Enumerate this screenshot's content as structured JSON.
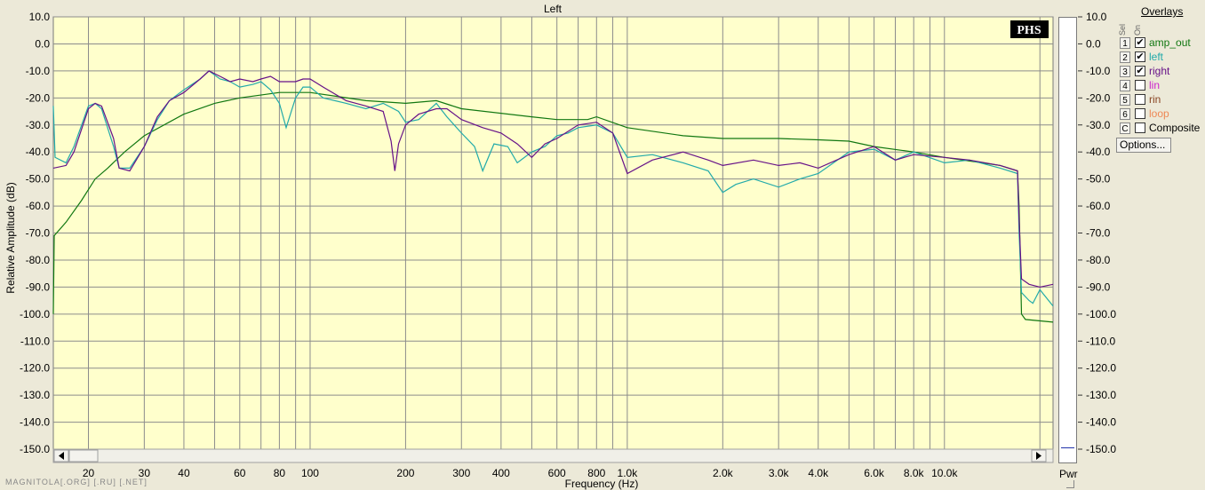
{
  "chart_data": {
    "type": "line",
    "title": "Left",
    "xlabel": "Frequency (Hz)",
    "ylabel": "Relative Amplitude (dB)",
    "x_scale": "log",
    "xlim": [
      15.5,
      22000
    ],
    "ylim": [
      -150,
      10
    ],
    "grid": true,
    "y_ticks": [
      "10.0",
      "0.0",
      "-10.0",
      "-20.0",
      "-30.0",
      "-40.0",
      "-50.0",
      "-60.0",
      "-70.0",
      "-80.0",
      "-90.0",
      "-100.0",
      "-110.0",
      "-120.0",
      "-130.0",
      "-140.0",
      "-150.0"
    ],
    "x_tick_labels": [
      {
        "f": 20,
        "t": "20"
      },
      {
        "f": 30,
        "t": "30"
      },
      {
        "f": 40,
        "t": "40"
      },
      {
        "f": 60,
        "t": "60"
      },
      {
        "f": 80,
        "t": "80"
      },
      {
        "f": 100,
        "t": "100"
      },
      {
        "f": 200,
        "t": "200"
      },
      {
        "f": 300,
        "t": "300"
      },
      {
        "f": 400,
        "t": "400"
      },
      {
        "f": 600,
        "t": "600"
      },
      {
        "f": 800,
        "t": "800"
      },
      {
        "f": 1000,
        "t": "1.0k"
      },
      {
        "f": 2000,
        "t": "2.0k"
      },
      {
        "f": 3000,
        "t": "3.0k"
      },
      {
        "f": 4000,
        "t": "4.0k"
      },
      {
        "f": 6000,
        "t": "6.0k"
      },
      {
        "f": 8000,
        "t": "8.0k"
      },
      {
        "f": 10000,
        "t": "10.0k"
      }
    ],
    "series": [
      {
        "name": "amp_out",
        "color": "#117711",
        "points": [
          [
            15.5,
            -100
          ],
          [
            15.6,
            -71
          ],
          [
            17,
            -66
          ],
          [
            19,
            -58
          ],
          [
            21,
            -50
          ],
          [
            23,
            -46
          ],
          [
            26,
            -40
          ],
          [
            30,
            -34
          ],
          [
            40,
            -26
          ],
          [
            50,
            -22
          ],
          [
            60,
            -20
          ],
          [
            80,
            -18
          ],
          [
            100,
            -18
          ],
          [
            150,
            -21
          ],
          [
            200,
            -22
          ],
          [
            250,
            -21
          ],
          [
            300,
            -24
          ],
          [
            500,
            -27
          ],
          [
            600,
            -28
          ],
          [
            750,
            -28
          ],
          [
            800,
            -27
          ],
          [
            1000,
            -31
          ],
          [
            1500,
            -34
          ],
          [
            2000,
            -35
          ],
          [
            3000,
            -35
          ],
          [
            4000,
            -35.5
          ],
          [
            5000,
            -36
          ],
          [
            6000,
            -38
          ],
          [
            8000,
            -40
          ],
          [
            10000,
            -42
          ],
          [
            15000,
            -45
          ],
          [
            17000,
            -47
          ],
          [
            17200,
            -60
          ],
          [
            17500,
            -100
          ],
          [
            18000,
            -102
          ],
          [
            22000,
            -103
          ]
        ]
      },
      {
        "name": "left",
        "color": "#22aaaa",
        "points": [
          [
            15.5,
            -23
          ],
          [
            15.7,
            -42
          ],
          [
            17,
            -44
          ],
          [
            18,
            -38
          ],
          [
            20,
            -23
          ],
          [
            21,
            -22
          ],
          [
            22,
            -24
          ],
          [
            24,
            -38
          ],
          [
            25,
            -46
          ],
          [
            27,
            -46
          ],
          [
            30,
            -38
          ],
          [
            33,
            -28
          ],
          [
            36,
            -21
          ],
          [
            40,
            -17
          ],
          [
            45,
            -13
          ],
          [
            48,
            -10
          ],
          [
            52,
            -13
          ],
          [
            56,
            -14
          ],
          [
            60,
            -16
          ],
          [
            66,
            -15
          ],
          [
            70,
            -14
          ],
          [
            75,
            -17
          ],
          [
            80,
            -22
          ],
          [
            84,
            -31
          ],
          [
            90,
            -20
          ],
          [
            95,
            -16
          ],
          [
            100,
            -16
          ],
          [
            110,
            -20
          ],
          [
            130,
            -22
          ],
          [
            150,
            -24
          ],
          [
            170,
            -22
          ],
          [
            190,
            -25
          ],
          [
            200,
            -29
          ],
          [
            220,
            -28
          ],
          [
            250,
            -22
          ],
          [
            270,
            -27
          ],
          [
            300,
            -33
          ],
          [
            330,
            -38
          ],
          [
            350,
            -47
          ],
          [
            380,
            -37
          ],
          [
            420,
            -38
          ],
          [
            450,
            -44
          ],
          [
            500,
            -40
          ],
          [
            550,
            -38
          ],
          [
            600,
            -34
          ],
          [
            650,
            -33
          ],
          [
            700,
            -31
          ],
          [
            800,
            -30
          ],
          [
            900,
            -33
          ],
          [
            1000,
            -42
          ],
          [
            1200,
            -41
          ],
          [
            1500,
            -44
          ],
          [
            1800,
            -47
          ],
          [
            2000,
            -55
          ],
          [
            2200,
            -52
          ],
          [
            2500,
            -50
          ],
          [
            3000,
            -53
          ],
          [
            3500,
            -50
          ],
          [
            4000,
            -48
          ],
          [
            5000,
            -40
          ],
          [
            6000,
            -39
          ],
          [
            7000,
            -43
          ],
          [
            8000,
            -40
          ],
          [
            10000,
            -44
          ],
          [
            12000,
            -43
          ],
          [
            15000,
            -46
          ],
          [
            17000,
            -48
          ],
          [
            17200,
            -70
          ],
          [
            17500,
            -92
          ],
          [
            18500,
            -95
          ],
          [
            19000,
            -96
          ],
          [
            20000,
            -91
          ],
          [
            22000,
            -97
          ]
        ]
      },
      {
        "name": "right",
        "color": "#661188",
        "points": [
          [
            15.5,
            -46
          ],
          [
            17,
            -45
          ],
          [
            18,
            -40
          ],
          [
            20,
            -24
          ],
          [
            21,
            -22
          ],
          [
            22,
            -23
          ],
          [
            24,
            -35
          ],
          [
            25,
            -46
          ],
          [
            27,
            -47
          ],
          [
            30,
            -38
          ],
          [
            33,
            -27
          ],
          [
            36,
            -21
          ],
          [
            40,
            -18
          ],
          [
            45,
            -13
          ],
          [
            48,
            -10
          ],
          [
            52,
            -12
          ],
          [
            56,
            -14
          ],
          [
            60,
            -13
          ],
          [
            66,
            -14
          ],
          [
            70,
            -13
          ],
          [
            75,
            -12
          ],
          [
            80,
            -14
          ],
          [
            90,
            -14
          ],
          [
            95,
            -13
          ],
          [
            100,
            -13
          ],
          [
            110,
            -16
          ],
          [
            130,
            -21
          ],
          [
            150,
            -23
          ],
          [
            170,
            -25
          ],
          [
            180,
            -36
          ],
          [
            185,
            -47
          ],
          [
            190,
            -37
          ],
          [
            200,
            -30
          ],
          [
            220,
            -26
          ],
          [
            250,
            -24
          ],
          [
            270,
            -24
          ],
          [
            300,
            -28
          ],
          [
            350,
            -31
          ],
          [
            400,
            -33
          ],
          [
            450,
            -37
          ],
          [
            500,
            -42
          ],
          [
            550,
            -37
          ],
          [
            600,
            -35
          ],
          [
            700,
            -30
          ],
          [
            800,
            -29
          ],
          [
            900,
            -33
          ],
          [
            1000,
            -48
          ],
          [
            1200,
            -43
          ],
          [
            1500,
            -40
          ],
          [
            1800,
            -43
          ],
          [
            2000,
            -45
          ],
          [
            2500,
            -43
          ],
          [
            3000,
            -45
          ],
          [
            3500,
            -44
          ],
          [
            4000,
            -46
          ],
          [
            5000,
            -41
          ],
          [
            6000,
            -38
          ],
          [
            7000,
            -43
          ],
          [
            8000,
            -41
          ],
          [
            10000,
            -42
          ],
          [
            12000,
            -43
          ],
          [
            15000,
            -45
          ],
          [
            17000,
            -47
          ],
          [
            17200,
            -65
          ],
          [
            17500,
            -87
          ],
          [
            18500,
            -89
          ],
          [
            20000,
            -90
          ],
          [
            22000,
            -89
          ]
        ]
      }
    ]
  },
  "overlays": {
    "title": "Overlays",
    "col_sel": "Sel",
    "col_on": "On",
    "rows": [
      {
        "num": "1",
        "checked": "✔",
        "label": "amp_out",
        "color": "#117711"
      },
      {
        "num": "2",
        "checked": "✔",
        "label": "left",
        "color": "#22aaaa"
      },
      {
        "num": "3",
        "checked": "✔",
        "label": "right",
        "color": "#661188"
      },
      {
        "num": "4",
        "checked": "",
        "label": "lin",
        "color": "#cc22cc"
      },
      {
        "num": "5",
        "checked": "",
        "label": "rin",
        "color": "#884422"
      },
      {
        "num": "6",
        "checked": "",
        "label": "loop",
        "color": "#ee8855"
      },
      {
        "num": "C",
        "checked": "",
        "label": "Composite",
        "color": "#000000"
      }
    ],
    "options_label": "Options..."
  },
  "pwr_label": "Pwr",
  "watermark": "MAGNITOLA[.ORG] [.RU] [.NET]",
  "logo": "PHS"
}
